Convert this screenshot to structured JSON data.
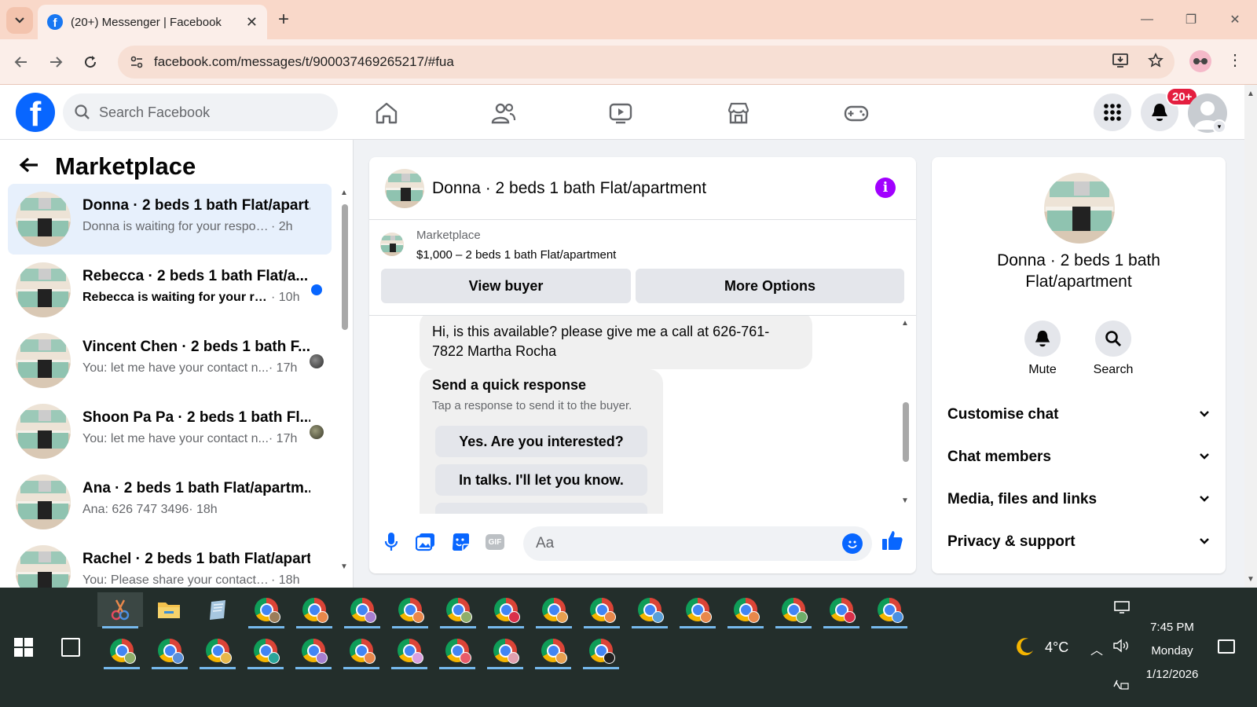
{
  "browser": {
    "tab_title": "(20+) Messenger | Facebook",
    "url": "facebook.com/messages/t/900037469265217/#fua",
    "window_controls": [
      "—",
      "❐",
      "✕"
    ]
  },
  "fb": {
    "search_placeholder": "Search Facebook",
    "notif_badge": "20+",
    "nav_icons": [
      "home-icon",
      "friends-icon",
      "video-icon",
      "marketplace-icon",
      "gaming-icon"
    ]
  },
  "chat_list": {
    "title": "Marketplace",
    "conversations": [
      {
        "name": "Donna · 2 beds 1 bath Flat/apart...",
        "preview": "Donna is waiting for your response.",
        "time": "· 2h",
        "state": "active"
      },
      {
        "name": "Rebecca · 2 beds 1 bath Flat/a...",
        "preview": "Rebecca is waiting for your res...",
        "time": "· 10h",
        "state": "unread"
      },
      {
        "name": "Vincent Chen · 2 beds 1 bath F...",
        "preview": "You: let me have your contact n...",
        "time": "· 17h",
        "state": "seen"
      },
      {
        "name": "Shoon Pa Pa · 2 beds 1 bath Fl...",
        "preview": "You: let me have your contact n...",
        "time": "· 17h",
        "state": "seen"
      },
      {
        "name": "Ana · 2 beds 1 bath Flat/apartm...",
        "preview": "Ana: 626 747 3496",
        "time": "· 18h",
        "state": "read"
      },
      {
        "name": "Rachel · 2 beds 1 bath Flat/apart...",
        "preview": "You: Please share your contact nu...",
        "time": "· 18h",
        "state": "read"
      }
    ]
  },
  "conversation": {
    "title": "Donna · 2 beds 1 bath Flat/apartment",
    "marketplace_label": "Marketplace",
    "listing": "$1,000 – 2 beds 1 bath Flat/apartment",
    "view_buyer": "View buyer",
    "more_options": "More Options",
    "incoming_message": "Hi, is this available? please give me a call at 626-761-7822 Martha Rocha",
    "quick_title": "Send a quick response",
    "quick_subtitle": "Tap a response to send it to the buyer.",
    "quick_responses": [
      "Yes. Are you interested?",
      "In talks. I'll let you know."
    ],
    "composer_placeholder": "Aa"
  },
  "info_panel": {
    "name": "Donna · 2 beds 1 bath Flat/apartment",
    "mute": "Mute",
    "search": "Search",
    "sections": [
      "Customise chat",
      "Chat members",
      "Media, files and links",
      "Privacy & support"
    ]
  },
  "taskbar": {
    "weather_temp": "4°C",
    "time": "7:45 PM",
    "day": "Monday",
    "date": "1/12/2026",
    "row1_badge_colors": [
      "#9b7d5a",
      "#e8884b",
      "#a67fd0",
      "#e8884b",
      "#8fae6a",
      "#d9304a",
      "#e8a050",
      "#e8884b",
      "#5aa0d8",
      "#e8884b",
      "#e8884b",
      "#6fae6a",
      "#d9304a",
      "#4a90e2"
    ],
    "row2_badge_colors": [
      "#8fae6a",
      "#5a8fd8",
      "#e8b84b",
      "#2aa59a",
      "#a67fd0",
      "#e8884b",
      "#d9a0e0",
      "#e85b6a",
      "#e0a0b0",
      "#e8a050",
      "#222222"
    ]
  }
}
